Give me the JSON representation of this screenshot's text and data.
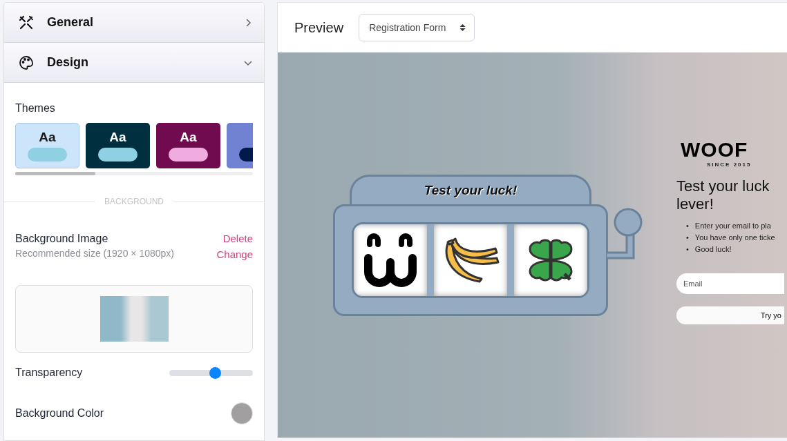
{
  "sections": [
    {
      "label": "General",
      "expanded": false
    },
    {
      "label": "Design",
      "expanded": true
    }
  ],
  "themes_label": "Themes",
  "themes": [
    {
      "sample": "Aa",
      "color": "#cde5fb",
      "selected": true
    },
    {
      "sample": "Aa",
      "color": "#002f40",
      "selected": false
    },
    {
      "sample": "Aa",
      "color": "#6f0b4e",
      "selected": false
    },
    {
      "color": "#7182d2",
      "selected": false
    }
  ],
  "divider_label": "BACKGROUND",
  "background_image": {
    "label": "Background Image",
    "hint": "Recommended size (1920 × 1080px)",
    "delete": "Delete",
    "change": "Change"
  },
  "transparency": {
    "label": "Transparency",
    "level": 0.55
  },
  "background_color": {
    "label": "Background Color",
    "color": "#a29fa0"
  },
  "preview": {
    "title": "Preview",
    "form_select": "Registration Form",
    "slot_title": "Test your luck!",
    "logo": {
      "name": "WOOF",
      "tagline": "SINCE 2015"
    },
    "heading_lines": [
      "Test your luck",
      "lever!"
    ],
    "bullets": [
      {
        "marker": "•",
        "text": "Enter your email to pla"
      },
      {
        "marker": "•",
        "text": "You have only one ticke"
      },
      {
        "marker": "•",
        "text": "Good luck!"
      }
    ],
    "email_placeholder": "Email",
    "button": "Try yo"
  }
}
